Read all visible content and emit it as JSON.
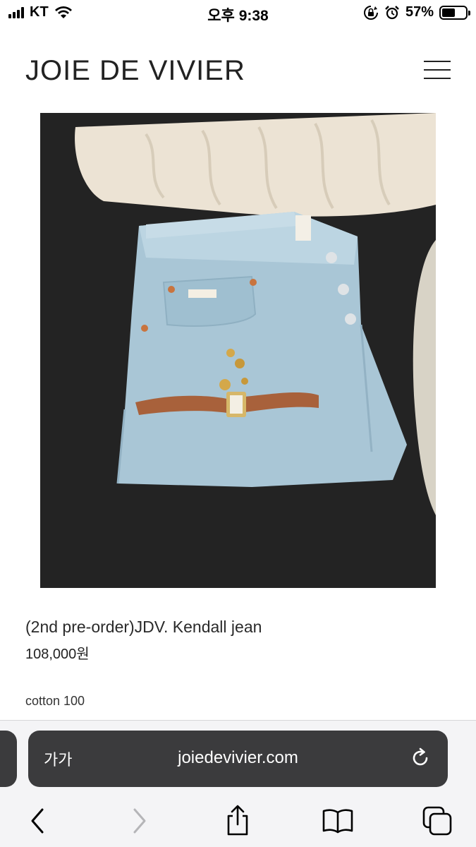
{
  "status_bar": {
    "carrier": "KT",
    "time": "오후 9:38",
    "battery_percent": "57%",
    "battery_level": 0.57
  },
  "header": {
    "brand": "JOIE DE VIVIER",
    "menu_icon": "hamburger-icon"
  },
  "product": {
    "title": "(2nd pre-order)JDV. Kendall jean",
    "price": "108,000원",
    "description": "cotton 100"
  },
  "browser": {
    "text_size_label": "가가",
    "url": "joiedevivier.com",
    "reload_icon": "reload-icon",
    "toolbar": [
      "back-icon",
      "forward-icon",
      "share-icon",
      "bookmarks-icon",
      "tabs-icon"
    ]
  },
  "colors": {
    "url_bar": "#3b3b3d",
    "toolbar_bg": "#f4f4f6",
    "forward_disabled": "#b5b5b8"
  }
}
